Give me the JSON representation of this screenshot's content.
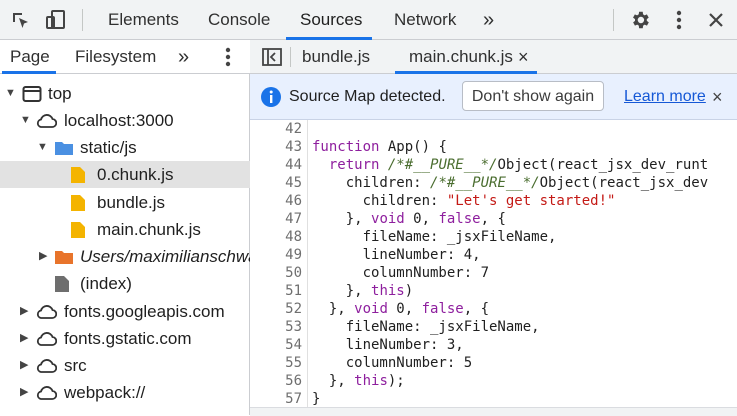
{
  "toolbar": {
    "tabs": [
      "Elements",
      "Console",
      "Sources",
      "Network"
    ],
    "more_tabs_label": "»",
    "active_tab": "Sources",
    "icons": [
      "inspect-element-icon",
      "device-toolbar-icon",
      "settings-icon",
      "more-options-icon",
      "close-icon"
    ]
  },
  "navigator": {
    "tabs": [
      "Page",
      "Filesystem"
    ],
    "more_tabs_label": "»",
    "active_tab": "Page",
    "tree": [
      {
        "label": "top",
        "type": "frame",
        "expanded": true
      },
      {
        "label": "localhost:3000",
        "type": "cloud",
        "expanded": true
      },
      {
        "label": "static/js",
        "type": "folder",
        "expanded": true
      },
      {
        "label": "0.chunk.js",
        "type": "file",
        "selected": true
      },
      {
        "label": "bundle.js",
        "type": "file"
      },
      {
        "label": "main.chunk.js",
        "type": "file"
      },
      {
        "label": "Users/maximilianschwa",
        "type": "folder-orange",
        "expanded": false
      },
      {
        "label": "(index)",
        "type": "doc"
      },
      {
        "label": "fonts.googleapis.com",
        "type": "cloud",
        "expanded": false
      },
      {
        "label": "fonts.gstatic.com",
        "type": "cloud",
        "expanded": false
      },
      {
        "label": "src",
        "type": "cloud",
        "expanded": false
      },
      {
        "label": "webpack://",
        "type": "cloud",
        "expanded": false
      }
    ]
  },
  "editor": {
    "tabs": [
      {
        "label": "bundle.js",
        "closable": false
      },
      {
        "label": "main.chunk.js",
        "closable": true,
        "close_label": "×"
      }
    ],
    "active_tab": "main.chunk.js",
    "infobar": {
      "message": "Source Map detected.",
      "dismiss_button": "Don't show again",
      "link": "Learn more",
      "close_label": "×"
    },
    "code_lines": [
      {
        "n": "42",
        "text": ""
      },
      {
        "n": "43",
        "text": "function App() {"
      },
      {
        "n": "44",
        "text": "  return /*#__PURE__*/Object(react_jsx_dev_runt"
      },
      {
        "n": "45",
        "text": "    children: /*#__PURE__*/Object(react_jsx_dev"
      },
      {
        "n": "46",
        "text": "      children: \"Let's get started!\""
      },
      {
        "n": "47",
        "text": "    }, void 0, false, {"
      },
      {
        "n": "48",
        "text": "      fileName: _jsxFileName,"
      },
      {
        "n": "49",
        "text": "      lineNumber: 4,"
      },
      {
        "n": "50",
        "text": "      columnNumber: 7"
      },
      {
        "n": "51",
        "text": "    }, this)"
      },
      {
        "n": "52",
        "text": "  }, void 0, false, {"
      },
      {
        "n": "53",
        "text": "    fileName: _jsxFileName,"
      },
      {
        "n": "54",
        "text": "    lineNumber: 3,"
      },
      {
        "n": "55",
        "text": "    columnNumber: 5"
      },
      {
        "n": "56",
        "text": "  }, this);"
      },
      {
        "n": "57",
        "text": "}"
      }
    ]
  },
  "colors": {
    "accent": "#1a73e8",
    "toolbar_bg": "#f1f3f4",
    "selected_row": "#e2e2e2",
    "infobar_bg": "#e8f0fe"
  }
}
